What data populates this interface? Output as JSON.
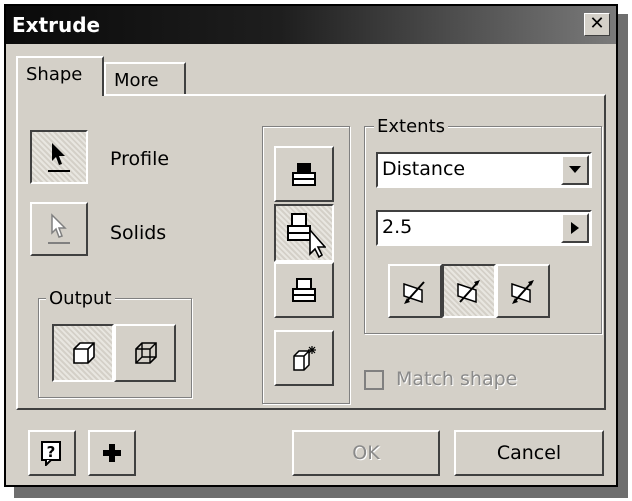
{
  "window": {
    "title": "Extrude",
    "close_glyph": "✕"
  },
  "tabs": [
    {
      "label": "Shape",
      "active": true
    },
    {
      "label": "More",
      "active": false
    }
  ],
  "profile": {
    "label": "Profile",
    "icon": "cursor-arrow-icon"
  },
  "solids": {
    "label": "Solids",
    "icon": "cursor-arrow-disabled-icon"
  },
  "output": {
    "title": "Output",
    "buttons": [
      "solid-box-icon",
      "surface-box-icon"
    ]
  },
  "operations": {
    "buttons": [
      "join-icon",
      "cut-icon",
      "intersect-icon",
      "new-solid-icon"
    ]
  },
  "extents": {
    "title": "Extents",
    "type_value": "Distance",
    "distance_value": "2.5",
    "directions": [
      "direction-1-icon",
      "direction-2-icon",
      "symmetric-icon"
    ]
  },
  "match_shape": {
    "label": "Match shape",
    "checked": false,
    "enabled": false
  },
  "footer": {
    "ok_label": "OK",
    "cancel_label": "Cancel",
    "help_icon": "help-icon",
    "plus_icon": "plus-icon"
  },
  "colors": {
    "dialog_bg": "#d4d0c8",
    "title_bar": "#000000",
    "disabled_text": "#8a8a8a"
  }
}
